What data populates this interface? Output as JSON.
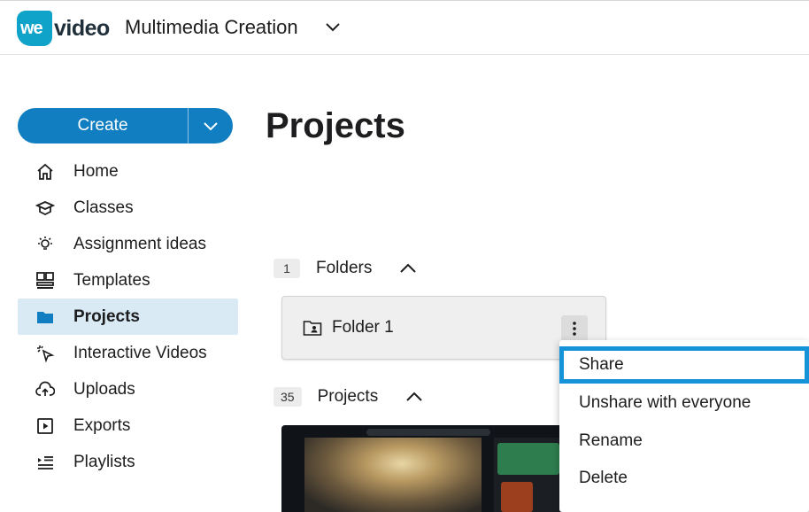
{
  "app": {
    "logo_text": "wevideo",
    "workspace_name": "Multimedia Creation"
  },
  "sidebar": {
    "create_label": "Create",
    "items": [
      {
        "label": "Home",
        "icon": "home-icon",
        "active": false
      },
      {
        "label": "Classes",
        "icon": "classes-icon",
        "active": false
      },
      {
        "label": "Assignment ideas",
        "icon": "lightbulb-icon",
        "active": false
      },
      {
        "label": "Templates",
        "icon": "templates-icon",
        "active": false
      },
      {
        "label": "Projects",
        "icon": "folder-icon",
        "active": true
      },
      {
        "label": "Interactive Videos",
        "icon": "cursor-click-icon",
        "active": false
      },
      {
        "label": "Uploads",
        "icon": "cloud-upload-icon",
        "active": false
      },
      {
        "label": "Exports",
        "icon": "play-box-icon",
        "active": false
      },
      {
        "label": "Playlists",
        "icon": "playlist-icon",
        "active": false
      }
    ]
  },
  "main": {
    "title": "Projects",
    "folders_section": {
      "count": "1",
      "label": "Folders"
    },
    "folders": [
      {
        "name": "Folder 1"
      }
    ],
    "projects_section": {
      "count": "35",
      "label": "Projects"
    }
  },
  "context_menu": {
    "items": [
      "Share",
      "Unshare with everyone",
      "Rename",
      "Delete"
    ],
    "focused_index": 0
  },
  "colors": {
    "brand": "#10a3c9",
    "primary_button": "#117ec1",
    "active_nav": "#d9eaf5",
    "focus_ring": "#1593d9"
  }
}
